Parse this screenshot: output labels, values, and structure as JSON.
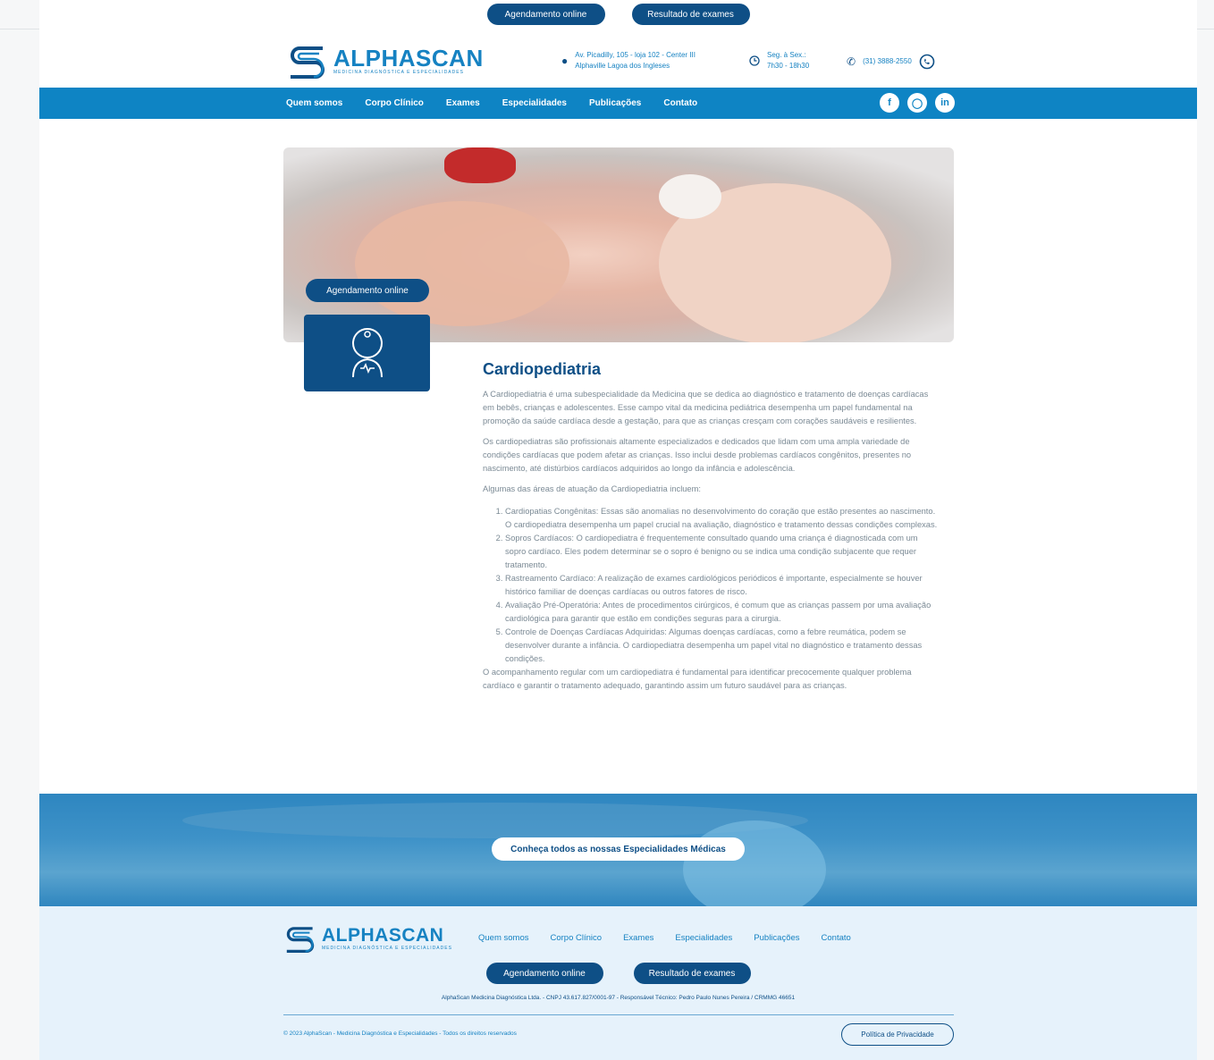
{
  "topbar": {
    "schedule_label": "Agendamento online",
    "results_label": "Resultado de exames"
  },
  "brand": {
    "name": "ALPHASCAN",
    "tagline": "MEDICINA DIAGNÓSTICA E ESPECIALIDADES"
  },
  "header": {
    "address_line1": "Av. Picadilly, 105 - loja 102 - Center III",
    "address_line2": "Alphaville Lagoa dos Ingleses",
    "hours_line1": "Seg. à Sex.:",
    "hours_line2": "7h30 - 18h30",
    "phone": "(31) 3888-2550"
  },
  "nav": {
    "items": [
      "Quem somos",
      "Corpo Clínico",
      "Exames",
      "Especialidades",
      "Publicações",
      "Contato"
    ]
  },
  "hero": {
    "button_label": "Agendamento online"
  },
  "article": {
    "title": "Cardiopediatria",
    "p1": "A Cardiopediatria é uma subespecialidade da Medicina que se dedica ao diagnóstico e tratamento de doenças cardíacas em bebês, crianças e adolescentes. Esse campo vital da medicina pediátrica desempenha um papel fundamental na promoção da saúde cardíaca desde a gestação, para que as crianças cresçam com corações saudáveis e resilientes.",
    "p2": "Os cardiopediatras são profissionais altamente especializados e dedicados que lidam com uma ampla variedade de condições cardíacas que podem afetar as crianças. Isso inclui desde problemas cardíacos congênitos, presentes no nascimento, até distúrbios cardíacos adquiridos ao longo da infância e adolescência.",
    "list_intro": "Algumas das áreas de atuação da Cardiopediatria incluem:",
    "list": [
      "Cardiopatias Congênitas: Essas são anomalias no desenvolvimento do coração que estão presentes ao nascimento. O cardiopediatra desempenha um papel crucial na avaliação, diagnóstico e tratamento dessas condições complexas.",
      "Sopros Cardíacos: O cardiopediatra é frequentemente consultado quando uma criança é diagnosticada com um sopro cardíaco. Eles podem determinar se o sopro é benigno ou se indica uma condição subjacente que requer tratamento.",
      "Rastreamento Cardíaco: A realização de exames cardiológicos periódicos é importante, especialmente se houver histórico familiar de doenças cardíacas ou outros fatores de risco.",
      "Avaliação Pré-Operatória: Antes de procedimentos cirúrgicos, é comum que as crianças passem por uma avaliação cardiológica para garantir que estão em condições seguras para a cirurgia.",
      "Controle de Doenças Cardíacas Adquiridas: Algumas doenças cardíacas, como a febre reumática, podem se desenvolver durante a infância. O cardiopediatra desempenha um papel vital no diagnóstico e tratamento dessas condições."
    ],
    "closing": "O acompanhamento regular com um cardiopediatra é fundamental para identificar precocemente qualquer problema cardíaco e garantir o tratamento adequado, garantindo assim um futuro saudável para as crianças."
  },
  "banner": {
    "button_label": "Conheça todos as nossas Especialidades Médicas"
  },
  "footer": {
    "links": [
      "Quem somos",
      "Corpo Clínico",
      "Exames",
      "Especialidades",
      "Publicações",
      "Contato"
    ],
    "schedule_label": "Agendamento online",
    "results_label": "Resultado de exames",
    "legal": "AlphaScan Medicina Diagnóstica Ltda. - CNPJ 43.617.827/0001-97 - Responsável Técnico: Pedro Paulo Nunes Pereira / CRMMG 46651",
    "copyright": "© 2023 AlphaScan - Medicina Diagnóstica e Especialidades - Todos os direitos reservados",
    "privacy_label": "Política de Privacidade"
  },
  "colors": {
    "primary_dark": "#0e4f86",
    "primary": "#0e84c4",
    "accent_text": "#1682c2",
    "footer_bg": "#e6f2fb"
  },
  "icons": [
    "map-pin-icon",
    "clock-icon",
    "phone-icon",
    "whatsapp-icon",
    "facebook-icon",
    "instagram-icon",
    "linkedin-icon",
    "baby-heart-icon"
  ]
}
